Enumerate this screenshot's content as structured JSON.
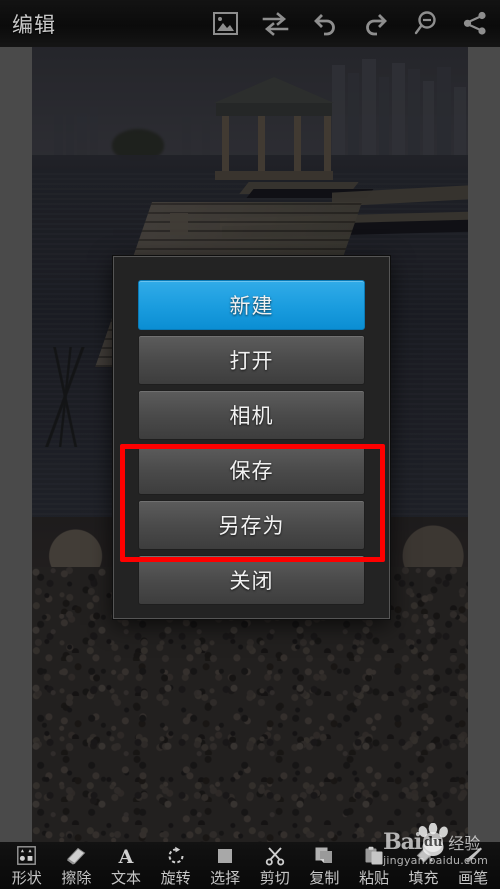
{
  "topbar": {
    "title": "编辑",
    "icons": [
      {
        "name": "image-icon",
        "label": "图片"
      },
      {
        "name": "swap-icon",
        "label": "切换"
      },
      {
        "name": "undo-icon",
        "label": "撤销"
      },
      {
        "name": "redo-icon",
        "label": "重做"
      },
      {
        "name": "zoom-out-icon",
        "label": "缩小"
      },
      {
        "name": "share-icon",
        "label": "分享"
      }
    ]
  },
  "photo": {
    "description": "黄昏湖景：木栈桥、湖心凉亭、远处高楼、前景碎石岸",
    "dimmed": true
  },
  "dialog": {
    "buttons": [
      {
        "label": "新建",
        "name": "new-button",
        "style": "primary"
      },
      {
        "label": "打开",
        "name": "open-button",
        "style": "normal"
      },
      {
        "label": "相机",
        "name": "camera-button",
        "style": "normal"
      },
      {
        "label": "保存",
        "name": "save-button",
        "style": "normal"
      },
      {
        "label": "另存为",
        "name": "save-as-button",
        "style": "normal"
      },
      {
        "label": "关闭",
        "name": "close-button",
        "style": "normal"
      }
    ],
    "highlight": {
      "color": "#ff0000",
      "covers": [
        "保存",
        "另存为"
      ]
    }
  },
  "bottombar": {
    "tools": [
      {
        "label": "形状",
        "icon": "shapes-icon"
      },
      {
        "label": "擦除",
        "icon": "eraser-icon"
      },
      {
        "label": "文本",
        "icon": "text-icon"
      },
      {
        "label": "旋转",
        "icon": "rotate-icon"
      },
      {
        "label": "选择",
        "icon": "select-icon"
      },
      {
        "label": "剪切",
        "icon": "cut-icon"
      },
      {
        "label": "复制",
        "icon": "copy-icon"
      },
      {
        "label": "粘贴",
        "icon": "paste-icon"
      },
      {
        "label": "填充",
        "icon": "fill-icon"
      },
      {
        "label": "画笔",
        "icon": "brush-icon"
      }
    ]
  },
  "watermark": {
    "bai": "Bai",
    "du": "du",
    "jingyan": "经验",
    "url": "jingyan.baidu.com"
  },
  "colors": {
    "accent_blue": "#1b9ddf",
    "highlight_red": "#ff0000",
    "bar_black": "#0c0c0c",
    "button_gray": "#4a4a4a",
    "canvas_gray": "#4a4a4a"
  }
}
